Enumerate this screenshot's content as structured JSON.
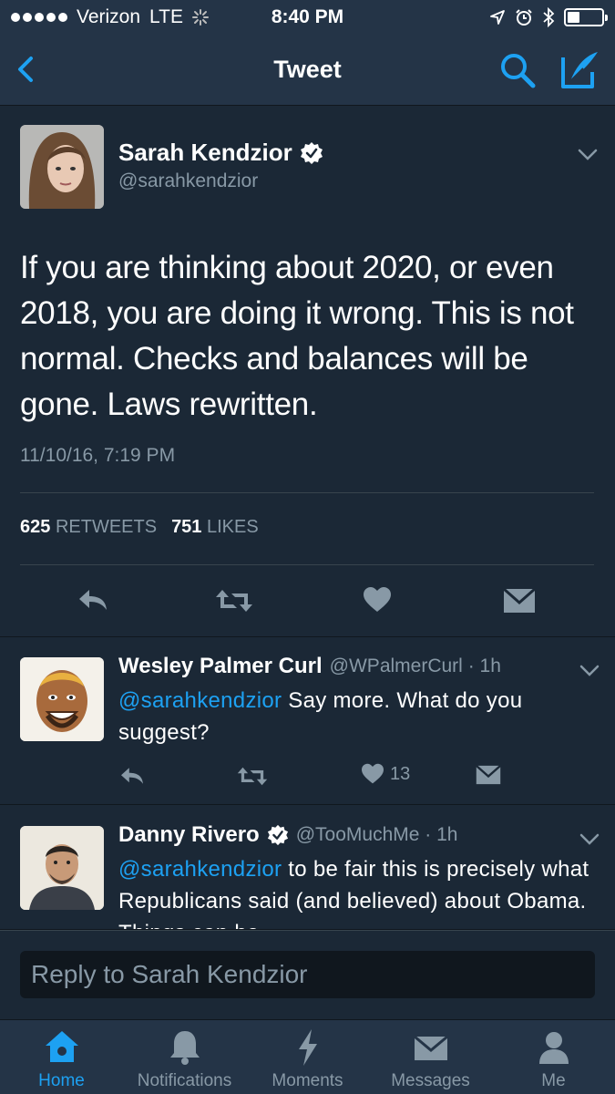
{
  "status_bar": {
    "carrier": "Verizon",
    "network": "LTE",
    "time": "8:40 PM",
    "battery_level": 0.35
  },
  "nav": {
    "title": "Tweet",
    "back_icon": "chevron-left-icon",
    "search_icon": "search-icon",
    "compose_icon": "compose-tweet-icon"
  },
  "main_tweet": {
    "author_name": "Sarah Kendzior",
    "author_handle": "@sarahkendzior",
    "verified": true,
    "text": "If you are thinking about 2020, or even 2018, you are doing it wrong. This is not normal. Checks and balances will be gone. Laws rewritten.",
    "timestamp": "11/10/16, 7:19 PM",
    "retweets_count": "625",
    "retweets_label": "RETWEETS",
    "likes_count": "751",
    "likes_label": "LIKES"
  },
  "replies": [
    {
      "name": "Wesley Palmer Curl",
      "handle": "@WPalmerCurl",
      "time": "· 1h",
      "verified": false,
      "mention": "@sarahkendzior",
      "text": " Say more.  What do you suggest?",
      "likes": "13"
    },
    {
      "name": "Danny Rivero",
      "handle": "@TooMuchMe",
      "time": "· 1h",
      "verified": true,
      "mention": "@sarahkendzior",
      "text": " to be fair this is precisely what Republicans said (and believed) about Obama. Things can be"
    }
  ],
  "composer": {
    "placeholder": "Reply to Sarah Kendzior"
  },
  "tabs": [
    {
      "label": "Home",
      "icon": "home-icon",
      "active": true
    },
    {
      "label": "Notifications",
      "icon": "bell-icon",
      "active": false
    },
    {
      "label": "Moments",
      "icon": "lightning-icon",
      "active": false
    },
    {
      "label": "Messages",
      "icon": "envelope-icon",
      "active": false
    },
    {
      "label": "Me",
      "icon": "person-icon",
      "active": false
    }
  ],
  "colors": {
    "background": "#1b2836",
    "bar": "#243447",
    "accent": "#1da1f2",
    "secondary_text": "#8899a6"
  }
}
